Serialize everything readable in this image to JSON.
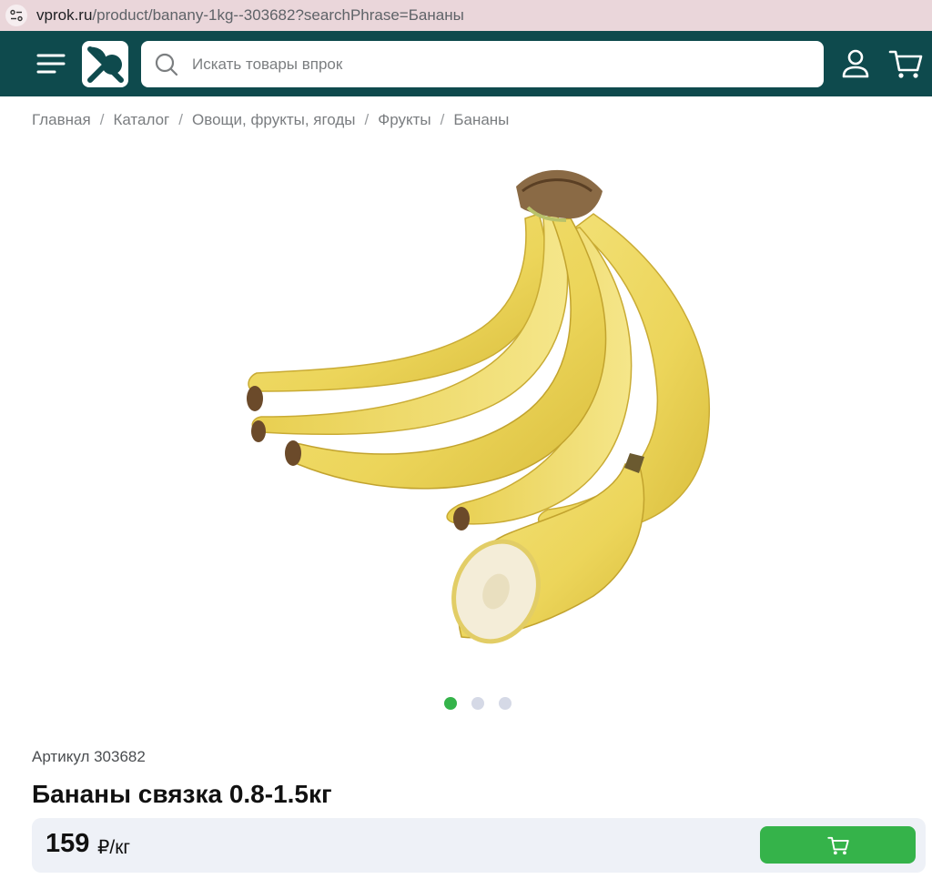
{
  "browser": {
    "url_host": "vprok.ru",
    "url_path": "/product/banany-1kg--303682?searchPhrase=Бананы"
  },
  "header": {
    "search_placeholder": "Искать товары впрок",
    "colors": {
      "background": "#0e4a4d",
      "accent": "#35b34a"
    }
  },
  "breadcrumbs": [
    "Главная",
    "Каталог",
    "Овощи, фрукты, ягоды",
    "Фрукты",
    "Бананы"
  ],
  "gallery": {
    "slide_count": 3,
    "active_index": 0,
    "image": "banana-bunch"
  },
  "product": {
    "sku_label": "Артикул 303682",
    "title": "Бананы связка 0.8-1.5кг",
    "price": "159",
    "unit": "₽/кг"
  },
  "icons": [
    "menu-icon",
    "logo",
    "search-icon",
    "user-icon",
    "cart-icon"
  ]
}
